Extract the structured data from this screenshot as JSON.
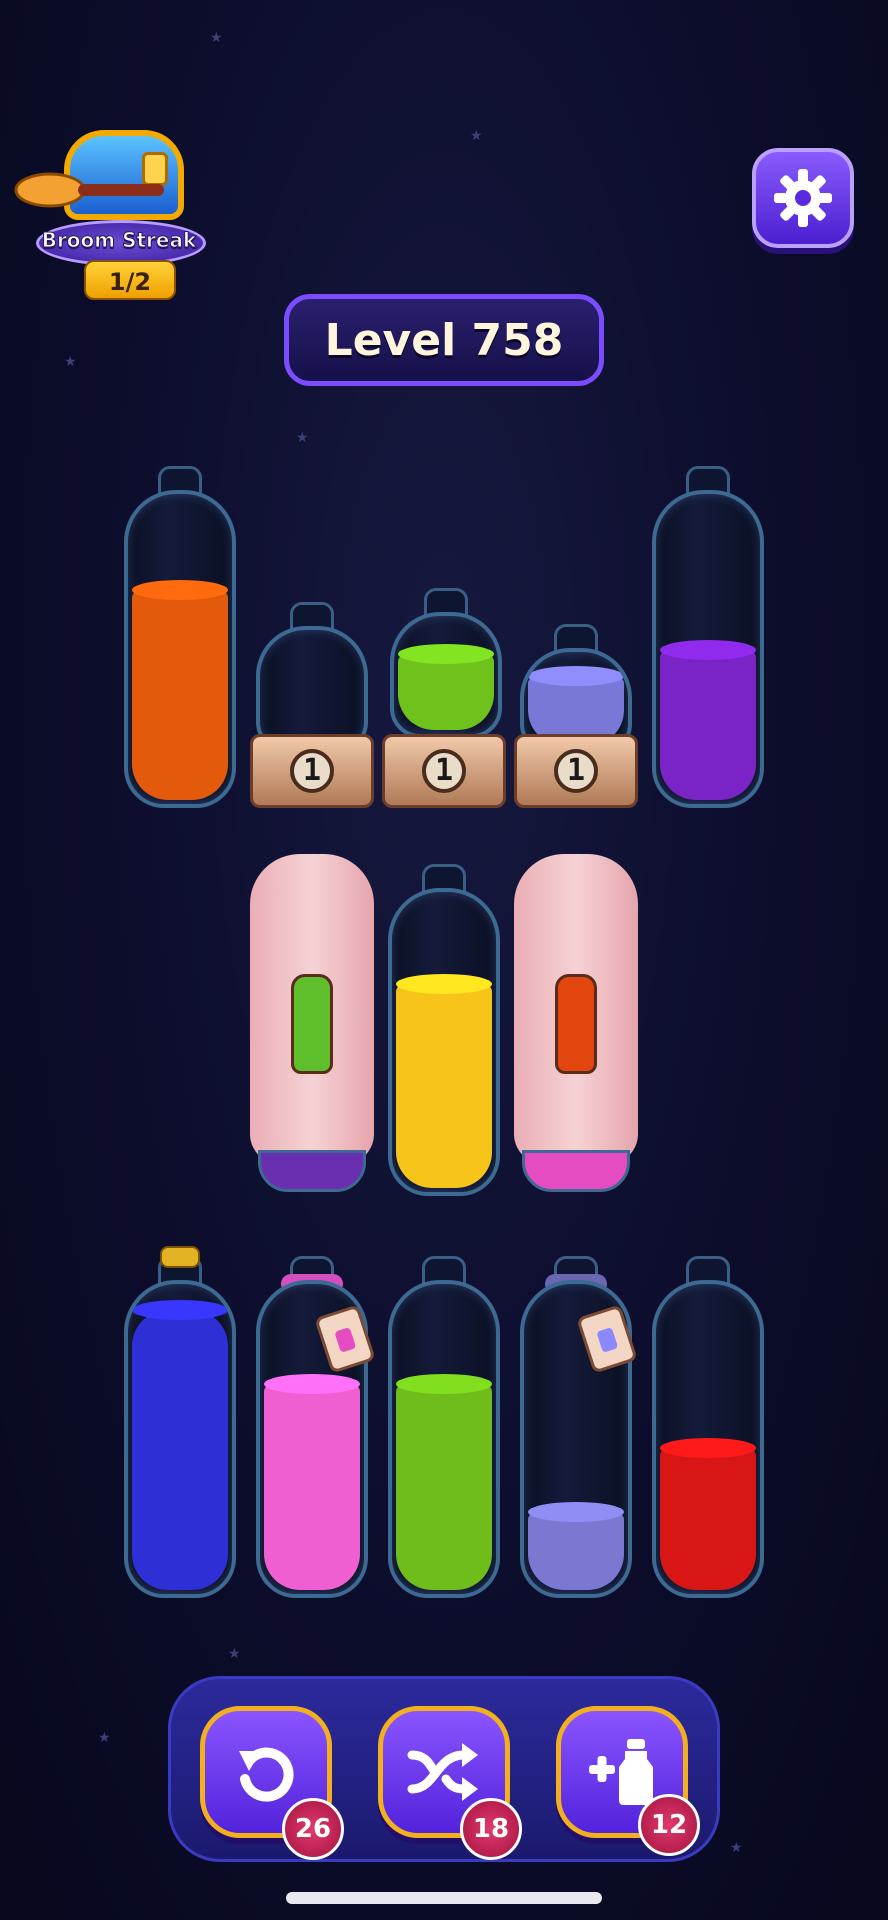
{
  "hud": {
    "streak_title": "Broom Streak",
    "streak_count": "1/2",
    "level_label": "Level 758"
  },
  "icons": {
    "settings": "gear-icon",
    "undo": "undo-icon",
    "shuffle": "shuffle-icon",
    "add_bottle": "add-bottle-icon"
  },
  "board": {
    "row1": [
      {
        "type": "bottle",
        "liquid_color": "#e35a0c",
        "fill": 0.63
      },
      {
        "type": "locked-small",
        "liquid_color": null,
        "fill": 0,
        "lock_count": "1"
      },
      {
        "type": "locked-small",
        "liquid_color": "#6fc21c",
        "fill": 0.5,
        "lock_count": "1"
      },
      {
        "type": "locked-small",
        "liquid_color": "#7a78d6",
        "fill": 0.55,
        "lock_count": "1"
      },
      {
        "type": "bottle",
        "liquid_color": "#7a24c8",
        "fill": 0.45
      }
    ],
    "row2": [
      {
        "type": "covered",
        "hint_color": "#5fbf2a",
        "base_color": "#6a2fb0"
      },
      {
        "type": "bottle",
        "liquid_color": "#f7c51a",
        "fill": 0.65
      },
      {
        "type": "covered",
        "hint_color": "#e0460e",
        "base_color": "#e64cc2"
      }
    ],
    "row3": [
      {
        "type": "bottle",
        "liquid_color": "#2f2fd6",
        "fill": 0.87,
        "corked": true
      },
      {
        "type": "bottle",
        "liquid_color": "#f05fd2",
        "fill": 0.65,
        "rope_color": "#d34fbf"
      },
      {
        "type": "bottle",
        "liquid_color": "#6ebd1a",
        "fill": 0.65
      },
      {
        "type": "bottle",
        "liquid_color": "#7a78d0",
        "fill": 0.25,
        "rope_color": "#6a66b0"
      },
      {
        "type": "bottle",
        "liquid_color": "#d91616",
        "fill": 0.45
      }
    ]
  },
  "toolbar": {
    "undo_count": "26",
    "shuffle_count": "18",
    "add_count": "12"
  }
}
